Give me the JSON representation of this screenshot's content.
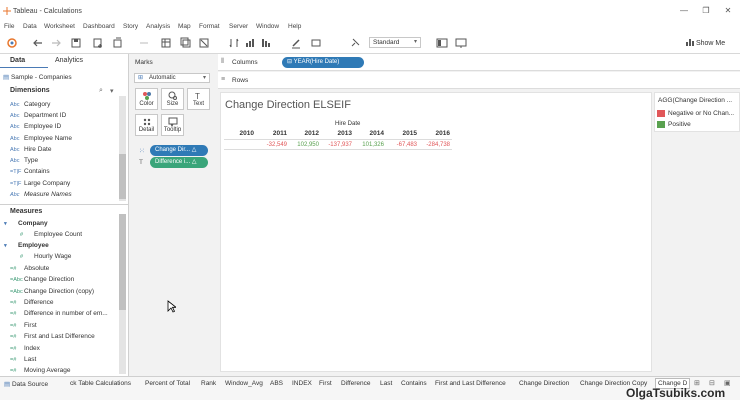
{
  "window": {
    "title": "Tableau - Calculations",
    "minimize": "—",
    "maximize": "❐",
    "close": "✕"
  },
  "menu": [
    "File",
    "Data",
    "Worksheet",
    "Dashboard",
    "Story",
    "Analysis",
    "Map",
    "Format",
    "Server",
    "Window",
    "Help"
  ],
  "toolbar": {
    "fit": "Standard",
    "show_me": "Show Me"
  },
  "data_pane": {
    "tabs": [
      "Data",
      "Analytics"
    ],
    "datasource": "Sample - Companies",
    "dimensions_header": "Dimensions",
    "dimensions": [
      {
        "icon": "Abc",
        "label": "Category"
      },
      {
        "icon": "Abc",
        "label": "Department ID"
      },
      {
        "icon": "Abc",
        "label": "Employee ID"
      },
      {
        "icon": "Abc",
        "label": "Employee Name"
      },
      {
        "icon": "Abc",
        "label": "Hire Date"
      },
      {
        "icon": "Abc",
        "label": "Type"
      },
      {
        "icon": "=T|F",
        "label": "Contains"
      },
      {
        "icon": "=T|F",
        "label": "Large Company"
      },
      {
        "icon": "Abc",
        "label": "Measure Names"
      }
    ],
    "measures_header": "Measures",
    "measures": [
      {
        "icon": "▾",
        "label": "Company"
      },
      {
        "icon": "#",
        "label": "Employee Count"
      },
      {
        "icon": "▾",
        "label": "Employee"
      },
      {
        "icon": "#",
        "label": "Hourly Wage"
      },
      {
        "icon": "=#",
        "label": "Absolute"
      },
      {
        "icon": "=Abc",
        "label": "Change Direction"
      },
      {
        "icon": "=Abc",
        "label": "Change Direction (copy)"
      },
      {
        "icon": "=#",
        "label": "Difference"
      },
      {
        "icon": "=#",
        "label": "Difference in number of em..."
      },
      {
        "icon": "=#",
        "label": "First"
      },
      {
        "icon": "=#",
        "label": "First and Last Difference"
      },
      {
        "icon": "=#",
        "label": "Index"
      },
      {
        "icon": "=#",
        "label": "Last"
      },
      {
        "icon": "=#",
        "label": "Moving Average"
      }
    ]
  },
  "marks": {
    "header": "Marks",
    "type": "Automatic",
    "buttons": [
      "Color",
      "Size",
      "Text",
      "Detail",
      "Tooltip"
    ],
    "pills": [
      "Change Dir...",
      "Difference i..."
    ]
  },
  "shelves": {
    "columns_label": "Columns",
    "columns_pill": "YEAR(Hire Date)",
    "rows_label": "Rows"
  },
  "view": {
    "title": "Change Direction ELSEIF",
    "header": "Hire Date",
    "years": [
      "2010",
      "2011",
      "2012",
      "2013",
      "2014",
      "2015",
      "2016"
    ],
    "values": [
      "",
      "-32,549",
      "102,950",
      "-137,937",
      "101,326",
      "-67,483",
      "-284,738"
    ],
    "value_colors": [
      "",
      "#e15759",
      "#59a14f",
      "#e15759",
      "#59a14f",
      "#e15759",
      "#e15759"
    ]
  },
  "legend": {
    "title": "AGG(Change Direction ...",
    "items": [
      {
        "label": "Negative or No Chan...",
        "color": "#e15759"
      },
      {
        "label": "Positive",
        "color": "#59a14f"
      }
    ]
  },
  "tabs": {
    "data_source": "Data Source",
    "sheets": [
      "ck Table Calculations",
      "Percent of Total",
      "Rank",
      "Window_Avg",
      "ABS",
      "INDEX",
      "First",
      "Difference",
      "Last",
      "Contains",
      "First and Last Difference",
      "Change Direction",
      "Change Direction Copy",
      "Change D"
    ],
    "active_index": 13
  },
  "watermark": "OlgaTsubiks.com"
}
